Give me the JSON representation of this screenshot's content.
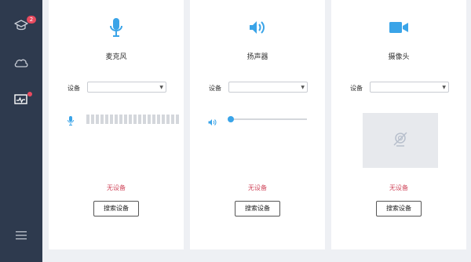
{
  "sidebar": {
    "items": [
      {
        "name": "course",
        "icon": "graduation-cap-icon",
        "badge": "2"
      },
      {
        "name": "cloud",
        "icon": "cloud-icon"
      },
      {
        "name": "device-check",
        "icon": "monitor-pulse-icon",
        "dot": true
      }
    ],
    "menu_icon": "hamburger-menu-icon"
  },
  "cards": {
    "microphone": {
      "icon": "microphone-icon",
      "title": "麦克风",
      "device_label": "设备",
      "device_value": "",
      "status": "无设备",
      "button": "搜索设备",
      "level_segments": 20
    },
    "speaker": {
      "icon": "speaker-icon",
      "title": "扬声器",
      "device_label": "设备",
      "device_value": "",
      "volume": 0,
      "status": "无设备",
      "button": "搜索设备"
    },
    "camera": {
      "icon": "video-camera-icon",
      "title": "摄像头",
      "device_label": "设备",
      "device_value": "",
      "preview_icon": "camera-off-icon",
      "status": "无设备",
      "button": "搜索设备"
    }
  },
  "colors": {
    "accent": "#3aa4e8",
    "sidebar": "#2e3a4e",
    "warning": "#d0485c",
    "badge": "#e84a5f"
  }
}
